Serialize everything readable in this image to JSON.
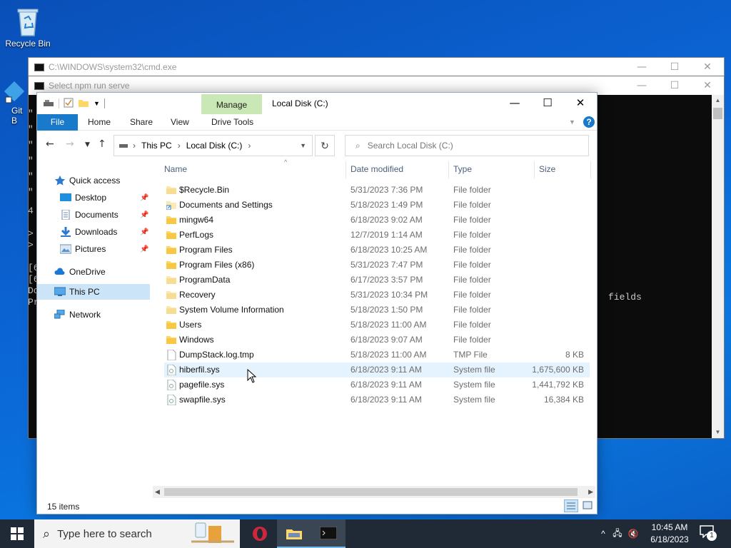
{
  "desktop": {
    "icons": [
      {
        "label": "Recycle Bin"
      },
      {
        "label": "Git B"
      }
    ]
  },
  "cmd_windows": [
    {
      "title": "C:\\WINDOWS\\system32\\cmd.exe"
    },
    {
      "title": "Select npm run serve",
      "visible_text": "fields"
    }
  ],
  "cmd_side_glyphs": [
    "\"",
    "\"",
    "\"",
    "\"",
    "\"",
    "\"",
    "4",
    ">",
    ">",
    "[6",
    "[6",
    "Do",
    "Pr"
  ],
  "explorer": {
    "title": "Local Disk (C:)",
    "contextual_tab": "Manage",
    "ribbon_tabs": [
      "File",
      "Home",
      "Share",
      "View",
      "Drive Tools"
    ],
    "address": {
      "segments": [
        "This PC",
        "Local Disk (C:)"
      ]
    },
    "search_placeholder": "Search Local Disk (C:)",
    "nav_pane": [
      {
        "label": "Quick access",
        "icon": "star-icon",
        "pinned": false
      },
      {
        "label": "Desktop",
        "icon": "desktop-folder-icon",
        "pinned": true
      },
      {
        "label": "Documents",
        "icon": "documents-icon",
        "pinned": true
      },
      {
        "label": "Downloads",
        "icon": "downloads-icon",
        "pinned": true
      },
      {
        "label": "Pictures",
        "icon": "pictures-icon",
        "pinned": true
      },
      {
        "label": "OneDrive",
        "icon": "cloud-icon",
        "pinned": false
      },
      {
        "label": "This PC",
        "icon": "computer-icon",
        "pinned": false,
        "selected": true
      },
      {
        "label": "Network",
        "icon": "network-icon",
        "pinned": false
      }
    ],
    "columns": [
      "Name",
      "Date modified",
      "Type",
      "Size"
    ],
    "files": [
      {
        "name": "$Recycle.Bin",
        "date": "5/31/2023 7:36 PM",
        "type": "File folder",
        "size": "",
        "icon": "folder-faded"
      },
      {
        "name": "Documents and Settings",
        "date": "5/18/2023 1:49 PM",
        "type": "File folder",
        "size": "",
        "icon": "folder-shortcut"
      },
      {
        "name": "mingw64",
        "date": "6/18/2023 9:02 AM",
        "type": "File folder",
        "size": "",
        "icon": "folder"
      },
      {
        "name": "PerfLogs",
        "date": "12/7/2019 1:14 AM",
        "type": "File folder",
        "size": "",
        "icon": "folder"
      },
      {
        "name": "Program Files",
        "date": "6/18/2023 10:25 AM",
        "type": "File folder",
        "size": "",
        "icon": "folder"
      },
      {
        "name": "Program Files (x86)",
        "date": "5/31/2023 7:47 PM",
        "type": "File folder",
        "size": "",
        "icon": "folder"
      },
      {
        "name": "ProgramData",
        "date": "6/17/2023 3:57 PM",
        "type": "File folder",
        "size": "",
        "icon": "folder-faded"
      },
      {
        "name": "Recovery",
        "date": "5/31/2023 10:34 PM",
        "type": "File folder",
        "size": "",
        "icon": "folder-faded"
      },
      {
        "name": "System Volume Information",
        "date": "5/18/2023 1:50 PM",
        "type": "File folder",
        "size": "",
        "icon": "folder-faded"
      },
      {
        "name": "Users",
        "date": "5/18/2023 11:00 AM",
        "type": "File folder",
        "size": "",
        "icon": "folder"
      },
      {
        "name": "Windows",
        "date": "6/18/2023 9:07 AM",
        "type": "File folder",
        "size": "",
        "icon": "folder"
      },
      {
        "name": "DumpStack.log.tmp",
        "date": "5/18/2023 11:00 AM",
        "type": "TMP File",
        "size": "8 KB",
        "icon": "file"
      },
      {
        "name": "hiberfil.sys",
        "date": "6/18/2023 9:11 AM",
        "type": "System file",
        "size": "1,675,600 KB",
        "icon": "sysfile",
        "hover": true
      },
      {
        "name": "pagefile.sys",
        "date": "6/18/2023 9:11 AM",
        "type": "System file",
        "size": "1,441,792 KB",
        "icon": "sysfile"
      },
      {
        "name": "swapfile.sys",
        "date": "6/18/2023 9:11 AM",
        "type": "System file",
        "size": "16,384 KB",
        "icon": "sysfile"
      }
    ],
    "status": "15 items"
  },
  "taskbar": {
    "search_placeholder": "Type here to search",
    "clock_time": "10:45 AM",
    "clock_date": "6/18/2023",
    "notification_count": "1"
  },
  "colors": {
    "file_tab": "#1979ca",
    "manage_tab": "#c9e8b6",
    "selection": "#cce4f7",
    "hover_row": "#e5f3ff",
    "folder": "#ffd768",
    "taskbar": "#1f2a36"
  }
}
